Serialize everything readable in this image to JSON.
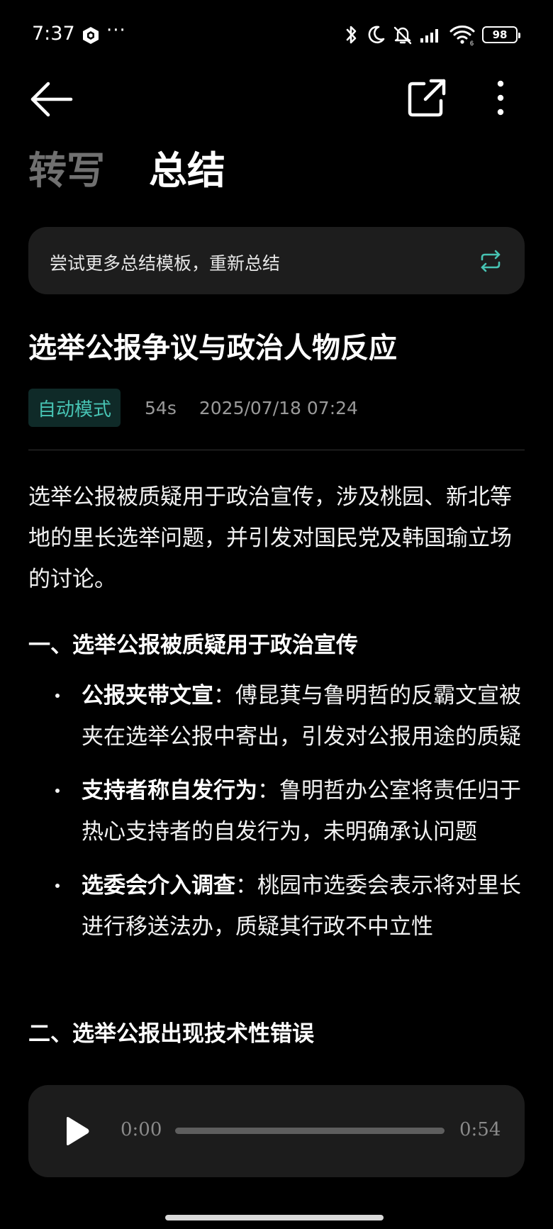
{
  "status_bar": {
    "time": "7:37",
    "more": "···",
    "battery": "98",
    "icons": [
      "app-hexagon-icon",
      "bluetooth-icon",
      "moon-icon",
      "bell-muted-icon",
      "signal-icon",
      "wifi-icon",
      "battery-icon"
    ]
  },
  "header": {
    "icons": [
      "back-arrow-icon",
      "share-icon",
      "more-vertical-icon"
    ]
  },
  "tabs": [
    {
      "label": "转写",
      "active": false
    },
    {
      "label": "总结",
      "active": true
    }
  ],
  "template_banner": {
    "text": "尝试更多总结模板，重新总结",
    "icon": "refresh-icon",
    "accent": "#47c3b3"
  },
  "summary": {
    "title": "选举公报争议与政治人物反应",
    "mode": "自动模式",
    "duration": "54s",
    "datetime": "2025/07/18 07:24",
    "intro": "选举公报被质疑用于政治宣传，涉及桃园、新北等地的里长选举问题，并引发对国民党及韩国瑜立场的讨论。",
    "sections": [
      {
        "heading": "一、选举公报被质疑用于政治宣传",
        "bullets": [
          {
            "term": "公报夹带文宣",
            "text": "：傅昆萁与鲁明哲的反霸文宣被夹在选举公报中寄出，引发对公报用途的质疑"
          },
          {
            "term": "支持者称自发行为",
            "text": "：鲁明哲办公室将责任归于热心支持者的自发行为，未明确承认问题"
          },
          {
            "term": "选委会介入调查",
            "text": "：桃园市选委会表示将对里长进行移送法办，质疑其行政不中立性"
          }
        ]
      },
      {
        "heading": "二、选举公报出现技术性错误",
        "bullets": []
      }
    ]
  },
  "player": {
    "current": "0:00",
    "total": "0:54",
    "progress": 0,
    "icon": "play-icon"
  },
  "colors": {
    "background": "#000000",
    "card": "#1d1d1d",
    "accent": "#47c3b3",
    "muted_text": "#9a9a9a"
  }
}
